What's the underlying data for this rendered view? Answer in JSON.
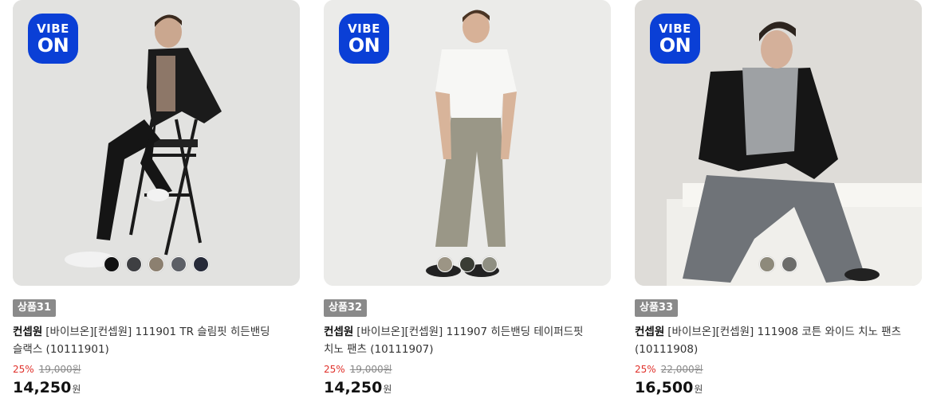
{
  "products": [
    {
      "badge_line1": "VIBE",
      "badge_line2": "ON",
      "swatch_colors": [
        "#111111",
        "#3e3f42",
        "#8c8070",
        "#5c5f66",
        "#262a38"
      ],
      "tag": "상품31",
      "brand": "컨셉원",
      "name": "[바이브온][컨셉원] 111901 TR 슬림핏 히든밴딩 슬랙스 (10111901)",
      "discount": "25%",
      "original_price": "19,000원",
      "price": "14,250",
      "currency": "원"
    },
    {
      "badge_line1": "VIBE",
      "badge_line2": "ON",
      "swatch_colors": [
        "#9c9585",
        "#3a3d35",
        "#8f8f82"
      ],
      "tag": "상품32",
      "brand": "컨셉원",
      "name": "[바이브온][컨셉원] 111907 히든밴딩 테이퍼드핏 치노 팬츠 (10111907)",
      "discount": "25%",
      "original_price": "19,000원",
      "price": "14,250",
      "currency": "원"
    },
    {
      "badge_line1": "VIBE",
      "badge_line2": "ON",
      "swatch_colors": [
        "#8e8a7b",
        "#6c6c6a"
      ],
      "tag": "상품33",
      "brand": "컨셉원",
      "name": "[바이브온][컨셉원] 111908 코튼 와이드 치노 팬츠 (10111908)",
      "discount": "25%",
      "original_price": "22,000원",
      "price": "16,500",
      "currency": "원"
    }
  ]
}
